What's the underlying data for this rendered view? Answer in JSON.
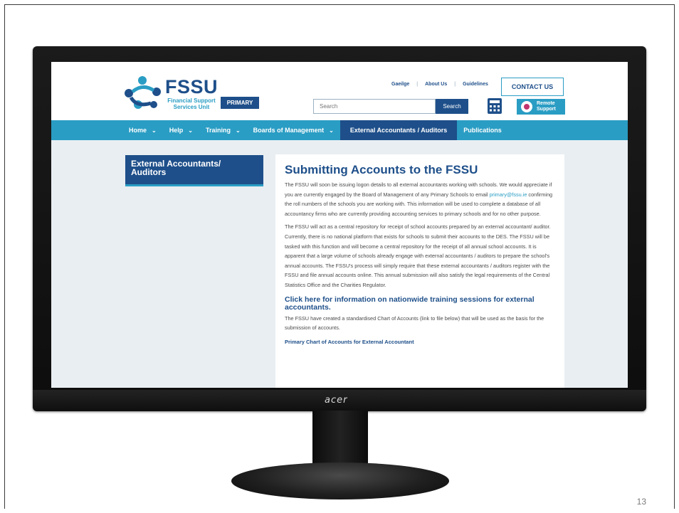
{
  "site": {
    "logo_title": "FSSU",
    "logo_subtitle_line1": "Financial Support",
    "logo_subtitle_line2": "Services Unit",
    "badge": "PRIMARY",
    "top_links": [
      "Gaeilge",
      "About Us",
      "Guidelines"
    ],
    "contact_label": "CONTACT US",
    "search_placeholder": "Search",
    "search_button": "Search",
    "remote_line1": "Remote",
    "remote_line2": "Support"
  },
  "nav": {
    "items": [
      {
        "label": "Home",
        "dropdown": true
      },
      {
        "label": "Help",
        "dropdown": true
      },
      {
        "label": "Training",
        "dropdown": true
      },
      {
        "label": "Boards of Management",
        "dropdown": true
      },
      {
        "label": "External Accountants / Auditors",
        "dropdown": false,
        "active": true
      },
      {
        "label": "Publications",
        "dropdown": false
      }
    ]
  },
  "sidebar": {
    "title_line1": "External Accountants/",
    "title_line2": "Auditors"
  },
  "main": {
    "heading": "Submitting Accounts to the FSSU",
    "para1_before_email": "The FSSU will soon be issuing logon details to all external accountants working with schools. We would appreciate if you are currently engaged by the Board of Management of any Primary Schools to email ",
    "email": "primary@fssu.ie",
    "para1_after_email": " confirming the roll numbers of the schools you are working with. This information will be used to complete a database of all accountancy firms who are currently providing accounting services to primary schools and for no other purpose.",
    "para2": "The FSSU will act as a central repository for receipt of school accounts prepared by an external accountant/ auditor. Currently, there is no national platform that exists for schools to submit their accounts to the DES. The FSSU will be tasked with this function and will become a central repository for the receipt of all annual school accounts. It is apparent that a large volume of schools already engage with external accountants / auditors to prepare the school's annual accounts. The FSSU's process will simply require that these external accountants / auditors register with the FSSU and file annual accounts online. This annual submission will also satisfy the legal requirements of the Central Statistics Office and the Charities Regulator.",
    "training_link": "Click here for information on nationwide training sessions for external accountants.",
    "para3": "The FSSU have created a standardised Chart of Accounts (link to file below) that will be used as the basis for the submission of accounts.",
    "file_link": "Primary Chart of Accounts for External Accountant"
  },
  "monitor": {
    "brand": "acer"
  },
  "slide": {
    "number": "13"
  },
  "colors": {
    "navy": "#1e4f8a",
    "teal": "#2a9dc4",
    "background": "#e9eef2"
  }
}
